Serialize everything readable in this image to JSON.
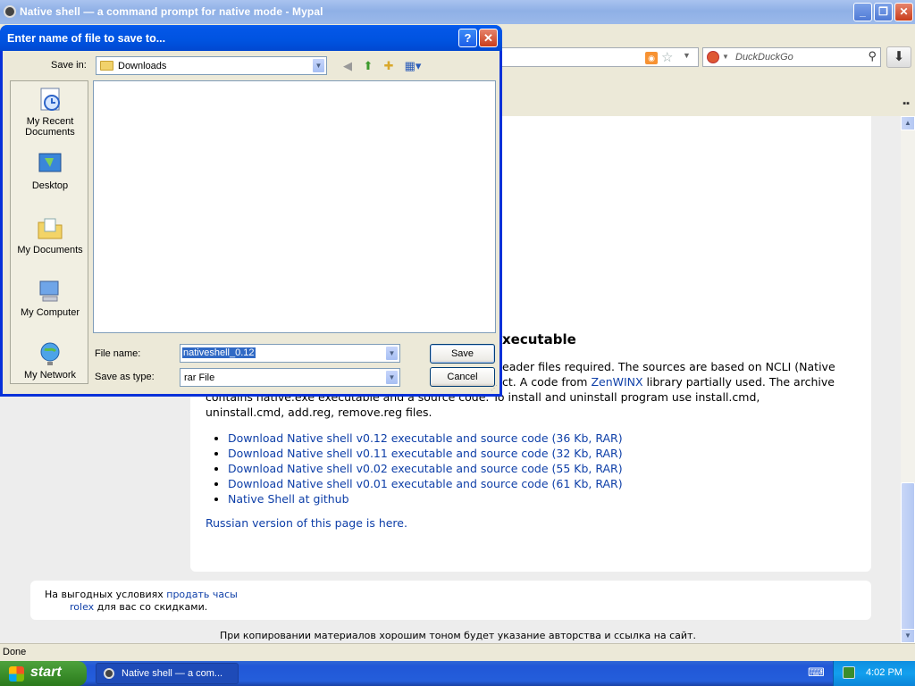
{
  "browser": {
    "title": "Native shell — a command prompt for native mode - Mypal",
    "search_placeholder": "DuckDuckGo",
    "status": "Done"
  },
  "page": {
    "heading_fragment": "xecutable",
    "para1_line1": "eader files required. The sources are based on NCLI (Native",
    "para1_line2_a": "ct. A code from ",
    "para1_line2_link": "ZenWINX",
    "para1_line2_b": " library partially used. The archive",
    "para1_line3": "contains native.exe executable and a source code. To install and uninstall program use install.cmd,",
    "para1_line4": "uninstall.cmd, add.reg, remove.reg files.",
    "links": [
      "Download Native shell v0.12 executable and source code (36 Kb, RAR)",
      "Download Native shell v0.11 executable and source code (32 Kb, RAR)",
      "Download Native shell v0.02 executable and source code (55 Kb, RAR)",
      "Download Native shell v0.01 executable and source code (61 Kb, RAR)",
      "Native Shell at github"
    ],
    "russian_a": "Russian version of this page is ",
    "russian_link": "here",
    "russian_b": ".",
    "ad_line1_a": "На выгодных условиях ",
    "ad_line1_link": "продать часы",
    "ad_line2_link": "rolex",
    "ad_line2_b": " для вас со скидками.",
    "footer": "При копировании материалов хорошим тоном будет указание авторства и ссылка на сайт."
  },
  "dialog": {
    "title": "Enter name of file to save to...",
    "save_in_label": "Save in:",
    "save_in_value": "Downloads",
    "places": [
      "My Recent Documents",
      "Desktop",
      "My Documents",
      "My Computer",
      "My Network"
    ],
    "file_name_label": "File name:",
    "file_name_value": "nativeshell_0.12",
    "save_as_type_label": "Save as type:",
    "save_as_type_value": "rar File",
    "save_button": "Save",
    "cancel_button": "Cancel",
    "help_glyph": "?",
    "close_glyph": "✕"
  },
  "taskbar": {
    "start_label": "start",
    "task_item": "Native shell — a com...",
    "clock": "4:02 PM"
  }
}
